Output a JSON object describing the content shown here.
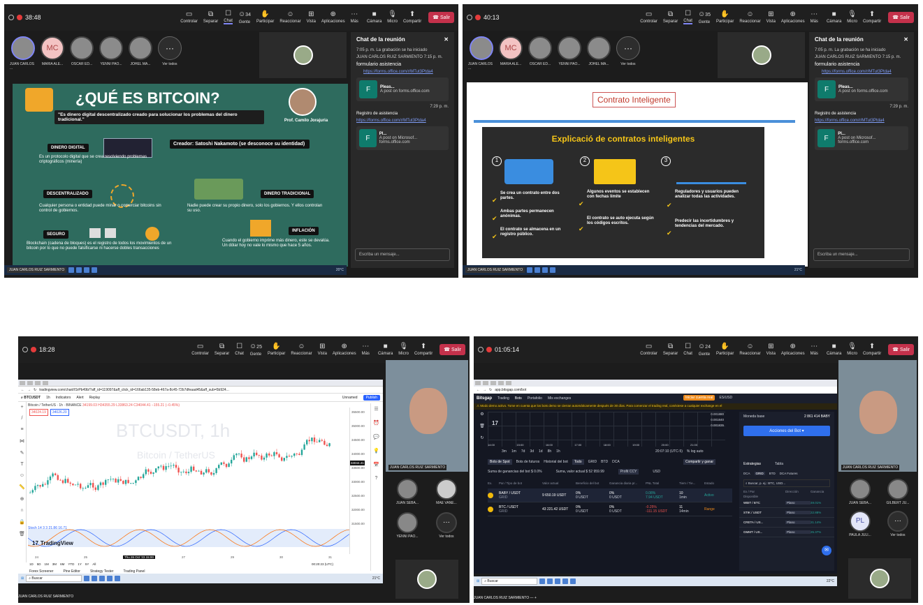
{
  "meeting": {
    "toolbar": {
      "controlar": "Controlar",
      "separar": "Separar",
      "chat": "Chat",
      "gente": "Gente",
      "participar": "Participar",
      "reaccionar": "Reaccionar",
      "vista": "Vista",
      "aplicaciones": "Aplicaciones",
      "mas": "Más",
      "camara": "Cámara",
      "micro": "Micro",
      "compartir": "Compartir",
      "salir": "Salir"
    },
    "participants": {
      "juan": "JUAN CARLOS ...",
      "maria": "MARIA ALE...",
      "oscar": "OSCAR ED...",
      "yenni": "YENNI PAO...",
      "johel": "JOHEL MA...",
      "ver_todos": "Ver todos",
      "mc_initials": "MC",
      "more": "···"
    },
    "chat": {
      "title": "Chat de la reunión",
      "recording": "7:05 p. m.   La grabación se ha iniciado",
      "sender": "JUAN CARLOS RUIZ SARMIENTO  7:15 p. m.",
      "form_label": "formulario asistencia",
      "form_link": "https://forms.office.com/r/MTut3Ptda4",
      "card1_title": "Pleas...",
      "card1_desc": "A post on forms.office.com",
      "time2": "7:29 p. m.",
      "registro": "Registro de asistencia",
      "registro_link": "https://forms.office.com/r/MTut3Ptda4",
      "card2_title": "Pl...",
      "card2_desc": "A post on Microsof... forms.office.com",
      "input_placeholder": "Escriba un mensaje..."
    },
    "presenter_name": "JUAN CARLOS RUIZ SARMIENTO"
  },
  "panel1": {
    "timer": "38:48",
    "people_count": "34",
    "slide": {
      "title": "¿QUÉ ES BITCOIN?",
      "quote": "\"Es dinero digital descentralizado creado para solucionar los problemas del dinero tradicional.\"",
      "prof": "Prof. Camilo Jorajuria",
      "creator": "Creador: Satoshi Nakamoto (se desconoce su identidad)",
      "dinero_digital": "DINERO DIGITAL",
      "dinero_digital_text": "Es un protocolo digital que se crea resolviendo problemas criptográficos (minería)",
      "descentralizado": "DESCENTRALIZADO",
      "descentralizado_text": "Cualquier persona o entidad puede minar o comerciar bitcoins sin control de gobiernos.",
      "dinero_tradicional": "DINERO TRADICIONAL",
      "dinero_tradicional_text": "Nadie puede crear su propio dinero, solo los gobiernos. Y ellos controlan su uso.",
      "seguro": "SEGURO",
      "seguro_text": "Blockchain (cadena de bloques) es el registro de todos los movimientos de un bitcoin por lo que no puede falsificarse ni hacerse dobles transacciones",
      "inflacion": "INFLACIÓN",
      "inflacion_text": "Cuando el gobierno imprime más dinero, este se devalúa. Un dólar hoy no vale lo mismo que hace 5 años."
    },
    "tray_temp": "20°C"
  },
  "panel2": {
    "timer": "40:13",
    "people_count": "35",
    "slide": {
      "title": "Contrato Inteligente",
      "subtitle": "Explicació de contratos inteligentes",
      "n1": "1",
      "n2": "2",
      "n3": "3",
      "c1a": "Se crea un contrato entre dos partes.",
      "c1b": "Ambas partes permanecen anónimas.",
      "c1c": "El contrato se almacena en un registro público.",
      "c2a": "Algunos eventos se establecen con fechas límite",
      "c2b": "El contrato se auto ejecuta según los códigos escritos.",
      "c3a": "Reguladores y usuarios pueden analizar todas las actividades.",
      "c3b": "Predecir las incertidumbres y tendencias del mercado."
    },
    "tray_temp": "21°C"
  },
  "panel3": {
    "timer": "18:28",
    "people_count": "25",
    "url": "tradingview.com/chart/ISrPb49b/?aff_id=119097&aff_click_id=166ab135-58eb-467a-8c45-72b7dfeaad45&aff_sub=5b924...",
    "symbol": "BTCUSDT",
    "interval": "1h",
    "pair_label": "Bitcoin / TetherUS · 1h · BINANCE",
    "ohlc": "34199.03 H34355.29 L33863.24 C34044.41 −155.21 (−0.45%)",
    "sell": "34024.19",
    "buy": "34026.20",
    "watermark": "BTCUSDT, 1h",
    "watermark2": "Bitcoin / TetherUS",
    "indicators": "Indicators",
    "alert": "Alert",
    "replay": "Replay",
    "unnamed": "Unnamed",
    "publish": "Publish",
    "tv_logo": "TradingView",
    "price_tag": "34044.41",
    "date_tag": "Thu 26 Oct '23  15:00",
    "ranges": [
      "1D",
      "5D",
      "1M",
      "3M",
      "6M",
      "YTD",
      "1Y",
      "5Y",
      "All"
    ],
    "clock": "00:20:23 (UTC)",
    "bottom_tabs": [
      "Forex Screener",
      "Pine Editor",
      "Strategy Tester",
      "Trading Panel"
    ],
    "stoch_label": "Stoch 14 3 3  21.86  16.71",
    "price_axis": [
      "35500.00",
      "35000.00",
      "34500.00",
      "34000.00",
      "33500.00",
      "33000.00",
      "32500.00",
      "32000.00",
      "31500.00"
    ],
    "time_axis": [
      "24",
      "25",
      "26",
      "27",
      "29",
      "30",
      "31"
    ],
    "search": "Buscar",
    "tray_temp": "21°C",
    "side_people": {
      "juan_seba": "JUAN SEBA...",
      "mae_vane": "MAE VANE...",
      "yenni_pao": "YENNI PAO...",
      "ver_todos": "Ver todos"
    },
    "cam_name": "JUAN CARLOS RUIZ SARMIENTO"
  },
  "panel4": {
    "timer": "01:05:14",
    "people_count": "24",
    "url": "app.bitsgap.com/bot",
    "nav": [
      "Bitsgap",
      "Trading",
      "Bots",
      "Portafolio",
      "Mis exchanges"
    ],
    "demo_msg": "Modo demo activo. Tome en cuenta que los bots demo se cierran automáticamente después de 30 días. Para comenzar el trading real, conéctese a cualquier exchange en el",
    "currency": "ES/USD",
    "demo_btn": "Iniciar cuenta real",
    "balance_label": "Moneda base",
    "balance_value": "2 861 414 BABY",
    "bot_actions": "Acciones del Bot",
    "timeframes": [
      "3m",
      "1m",
      "7d",
      "3d",
      "1d",
      "8h",
      "1h"
    ],
    "clock": "20:07:10 (UTC-5)",
    "log": "% log auto",
    "filters": [
      "Bots de Spot",
      "Bots de futuros",
      "Historial del bot",
      "Todo",
      "GRID",
      "BTD",
      "DCA"
    ],
    "compare": "Compartir y ganar",
    "profit_label": "Suma de ganancias del bot $ 0.0%",
    "current_label": "Suma, valor actual $ 52 959.99",
    "profit_ccy": "Profit CCY",
    "usd": "USD",
    "table_headers": [
      "Ex.",
      "Par / Tipo de bot",
      "Valor actual",
      "Beneficio del bot",
      "Ganancia diaria pr...",
      "PNL Total",
      "Tiem / Tie...",
      "Estado"
    ],
    "rows": [
      {
        "pair": "BABY / USDT",
        "type": "GRID",
        "value": "9 650.19 USDT",
        "bot_profit": "0%",
        "bot_profit_sub": "0 USDT",
        "daily": "0%",
        "daily_sub": "0 USDT",
        "pnl": "0.08%",
        "pnl_sub": "7.94 USDT",
        "time": "10",
        "time_sub": "1min",
        "status": "Activo"
      },
      {
        "pair": "BTC / USDT",
        "type": "GRID",
        "value": "43 221.42 USDT",
        "bot_profit": "0%",
        "bot_profit_sub": "0 USDT",
        "daily": "0%",
        "daily_sub": "0 USDT",
        "pnl": "-0.25%",
        "pnl_sub": "-111.15 USDT",
        "time": "11",
        "time_sub": "14min",
        "status": "Range"
      }
    ],
    "orderbook": [
      "0.001880",
      "0.001840",
      "0.001835"
    ],
    "strategies_tab": "Estrategias",
    "table_tab": "Tabla",
    "strat_filters": [
      "DCA",
      "GRID",
      "BTD",
      "DCA Futures"
    ],
    "strat_search": "Buscar, p. ej.: BTC, USD...",
    "strat_headers": [
      "Ex / Par",
      "Dirección",
      "Ganancia"
    ],
    "strat_available": "Disponible",
    "strat_rows": [
      {
        "pair": "WBIT / BTC",
        "dir": "Plano",
        "gain": "49.01%"
      },
      {
        "pair": "STIK / USDT",
        "dir": "Plano",
        "gain": "22.88%"
      },
      {
        "pair": "CRETA / US...",
        "dir": "Plano",
        "gain": "21.14%"
      },
      {
        "pair": "GMMT / US...",
        "dir": "Plano",
        "gain": "25.37%"
      }
    ],
    "search": "Buscar",
    "tray_temp": "22°C",
    "side_people": {
      "juan_seba": "JUAN SEBA...",
      "gilbert": "GILBERT JU...",
      "paula": "PAULA JULI...",
      "pl_initials": "PL",
      "ver_todos": "Ver todos"
    },
    "cam_name": "JUAN CARLOS RUIZ SARMIENTO",
    "bottom_name": "JUAN CARLOS RUIZ SARMIENTO",
    "price_axis": [
      "0.001880",
      "0.001840",
      "0.001835"
    ],
    "time_axis": [
      "14:00",
      "15:00",
      "16:00",
      "17:00",
      "18:00",
      "19:00",
      "20:00",
      "21:00"
    ]
  },
  "colors": {
    "teams_bg": "#1f1f1f",
    "leave_red": "#c4314b",
    "slide_green": "#2e6b5e",
    "tv_green": "#26a69a",
    "tv_red": "#ef5350",
    "bitsgap_blue": "#2f6fed"
  }
}
